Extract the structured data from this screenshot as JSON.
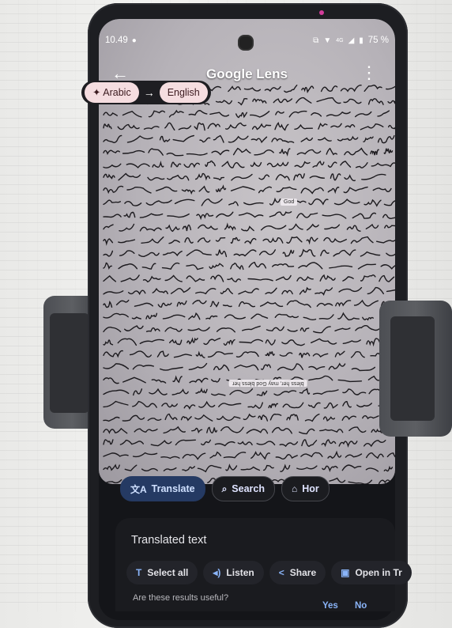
{
  "status_bar": {
    "time": "10.49",
    "battery": "75 %",
    "network": "4G"
  },
  "app_bar": {
    "title": "Google Lens",
    "back_icon": "arrow-back-icon",
    "more_icon": "more-vert-icon"
  },
  "language": {
    "source": "Arabic",
    "target": "English",
    "arrow": "→"
  },
  "overlays": {
    "god": "God",
    "bless": "bless her, may God bless her"
  },
  "mode_chips": [
    {
      "label": "Translate",
      "icon": "translate-icon",
      "active": true
    },
    {
      "label": "Search",
      "icon": "search-icon",
      "active": false
    },
    {
      "label": "Hor",
      "icon": "homework-icon",
      "active": false
    }
  ],
  "panel": {
    "title": "Translated text",
    "actions": [
      {
        "label": "Select all",
        "icon": "text-select-icon"
      },
      {
        "label": "Listen",
        "icon": "speaker-icon"
      },
      {
        "label": "Share",
        "icon": "share-icon"
      },
      {
        "label": "Open in Tr",
        "icon": "open-translate-icon"
      }
    ],
    "feedback_question": "Are these results useful?",
    "feedback_yes": "Yes",
    "feedback_no": "No"
  },
  "colors": {
    "accent": "#8ab4f8",
    "pill": "#f5dde0",
    "active_chip": "#253a63"
  }
}
